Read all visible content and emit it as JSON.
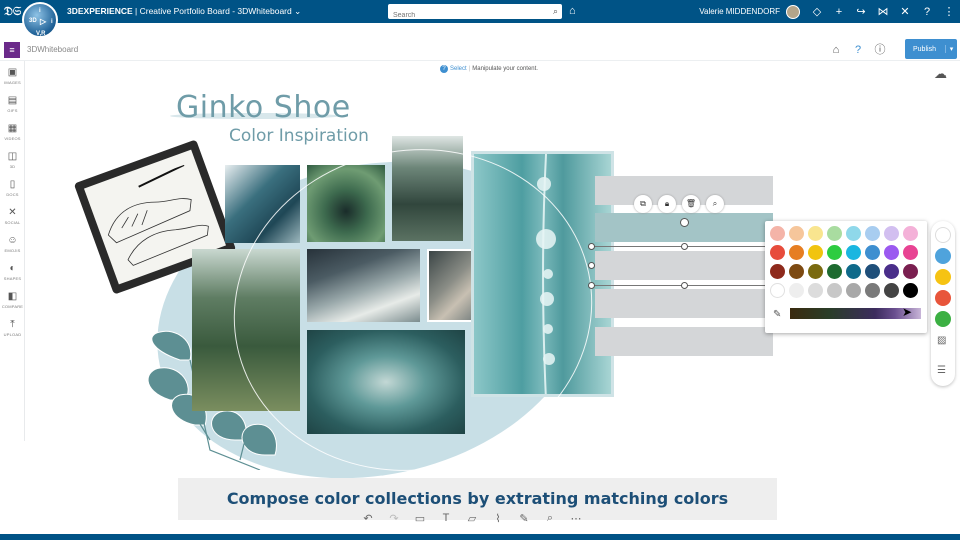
{
  "topbar": {
    "brand_bold": "3DEXPERIENCE",
    "separator": " | ",
    "context": "Creative Portfolio Board - 3DWhiteboard",
    "search_placeholder": "Search",
    "user": "Valerie MIDDENDORF",
    "compass_labels": [
      "3D",
      "V,R",
      "i",
      "i"
    ]
  },
  "subbar": {
    "widget_title": "3DWhiteboard",
    "publish_label": "Publish"
  },
  "tools": [
    {
      "label": "IMAGES",
      "icon": "image-icon"
    },
    {
      "label": "GIFS",
      "icon": "gif-icon"
    },
    {
      "label": "VIDEOS",
      "icon": "video-icon"
    },
    {
      "label": "3D",
      "icon": "cube-icon"
    },
    {
      "label": "DOCS",
      "icon": "document-icon"
    },
    {
      "label": "SOCIAL",
      "icon": "social-icon"
    },
    {
      "label": "EMOJIS",
      "icon": "emoji-icon"
    },
    {
      "label": "SHAPES",
      "icon": "shapes-icon"
    },
    {
      "label": "COMPARE",
      "icon": "compare-icon"
    },
    {
      "label": "UPLOAD",
      "icon": "upload-icon"
    }
  ],
  "hint": {
    "select": "Select",
    "text": "Manipulate your content."
  },
  "board": {
    "title": "Ginko Shoe",
    "subtitle": "Color Inspiration",
    "caption": "Compose color collections by extrating matching colors"
  },
  "palette": {
    "colors": [
      "#f4b4a8",
      "#f6c69b",
      "#f9e58f",
      "#a9dca0",
      "#8fd8ea",
      "#a8cdf0",
      "#d2bff0",
      "#f4b1d8",
      "#e74c3c",
      "#e67e22",
      "#f1c40f",
      "#2ecc40",
      "#1ab6e0",
      "#3e8fd0",
      "#9b59f0",
      "#e84393",
      "#8e2a1c",
      "#7d4a12",
      "#7a6a10",
      "#1e6b30",
      "#0f6a8a",
      "#1f4f7a",
      "#4a2e8a",
      "#7a1f50",
      "#ffffff",
      "#eeeeee",
      "#dcdcdc",
      "#c8c8c8",
      "#a8a8a8",
      "#7a7a7a",
      "#444444",
      "#000000"
    ]
  },
  "right_panel": {
    "colors": [
      "#ffffff",
      "#4fa3dc",
      "#f6c313",
      "#e8553b",
      "#3cb043"
    ]
  }
}
